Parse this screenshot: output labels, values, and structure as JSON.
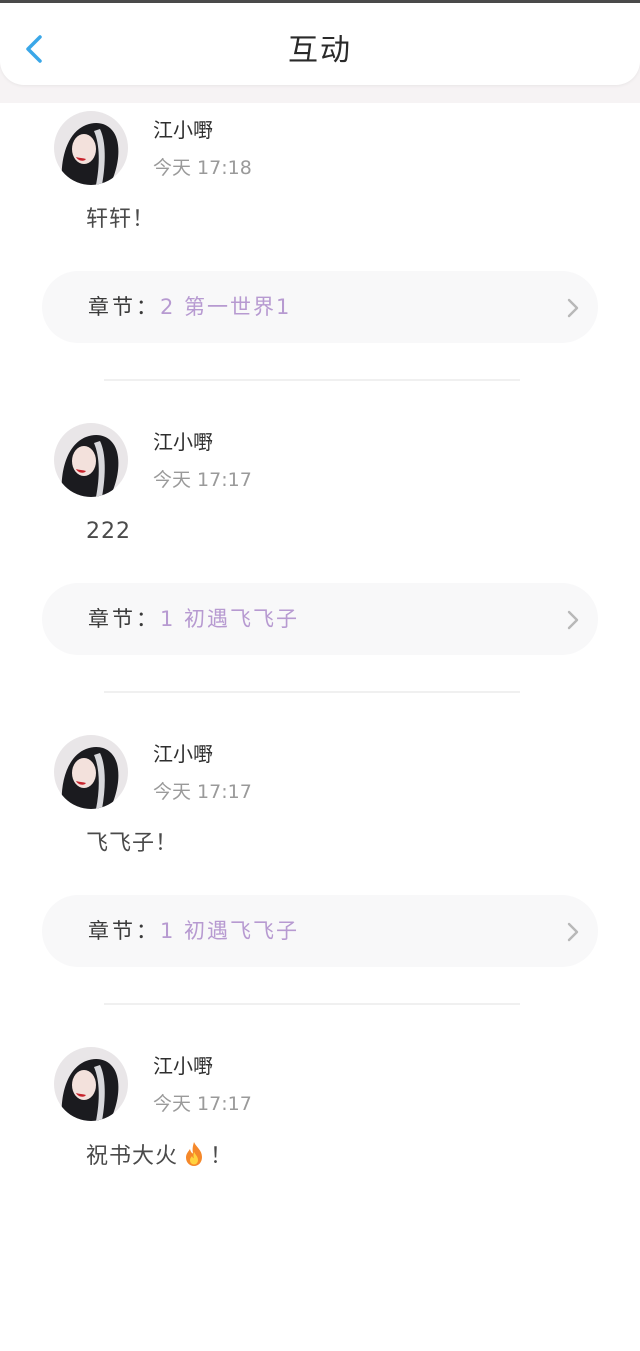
{
  "header": {
    "title": "互动",
    "back_icon": "chevron-left-icon",
    "accent_color": "#3aa7e8"
  },
  "posts": [
    {
      "username": "江小嘢",
      "time": "今天 17:18",
      "content": "轩轩！",
      "chapter_label": "章节：",
      "chapter_name": "2 第一世界1"
    },
    {
      "username": "江小嘢",
      "time": "今天 17:17",
      "content": "222",
      "chapter_label": "章节：",
      "chapter_name": "1 初遇飞飞子"
    },
    {
      "username": "江小嘢",
      "time": "今天 17:17",
      "content": "飞飞子！",
      "chapter_label": "章节：",
      "chapter_name": "1 初遇飞飞子"
    },
    {
      "username": "江小嘢",
      "time": "今天 17:17",
      "content_before_icon": "祝书大火",
      "content_icon": "fire-icon",
      "content_after_icon": "！"
    }
  ],
  "colors": {
    "chapter_accent": "#b79ad1",
    "timestamp": "#9a9a9a",
    "card_bg": "#f8f8f9"
  }
}
